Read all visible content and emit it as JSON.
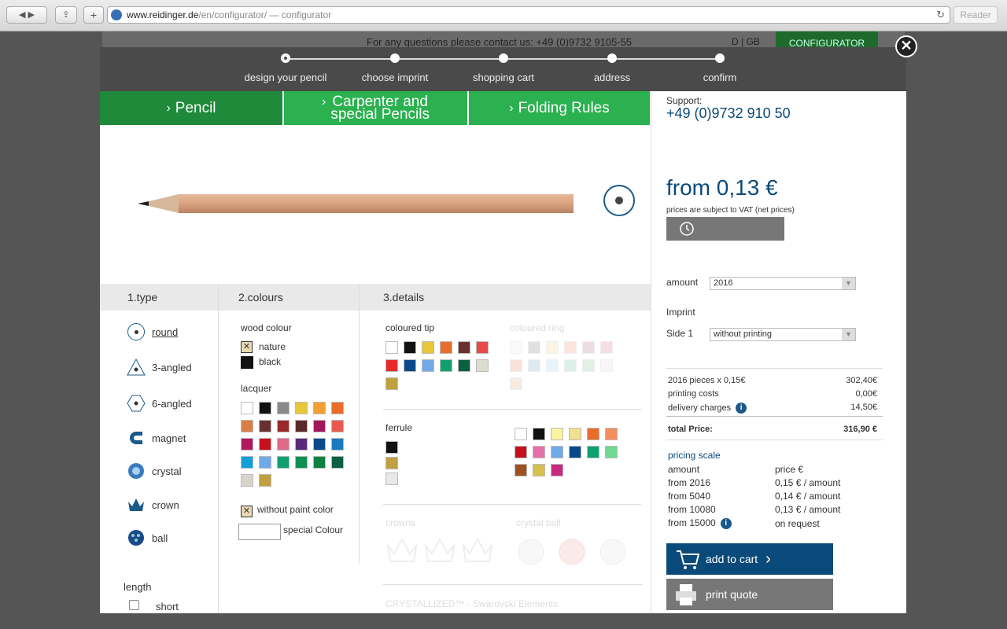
{
  "browser": {
    "url_host": "www.reidinger.de",
    "url_path": "/en/configurator/",
    "url_title": " — configurator",
    "reader": "Reader"
  },
  "background": {
    "contact": "For any questions please contact us: +49 (0)9732 9105-55",
    "lang_d": "D",
    "lang_sep": "|",
    "lang_gb": "GB",
    "configurator": "CONFIGURATOR"
  },
  "steps": [
    {
      "label": "design your pencil"
    },
    {
      "label": "choose imprint"
    },
    {
      "label": "shopping cart"
    },
    {
      "label": "address"
    },
    {
      "label": "confirm"
    }
  ],
  "close_icon": "close-icon",
  "tabs": {
    "pencil": "Pencil",
    "carpenter_1": "Carpenter and",
    "carpenter_2": "special Pencils",
    "folding": "Folding Rules"
  },
  "sections": {
    "type": "1.type",
    "colours": "2.colours",
    "details": "3.details"
  },
  "types": [
    "round",
    "3-angled",
    "6-angled",
    "magnet",
    "crystal",
    "crown",
    "ball"
  ],
  "length": {
    "title": "length",
    "option": "short"
  },
  "colours": {
    "wood_title": "wood colour",
    "wood": [
      "nature",
      "black"
    ],
    "lacquer_title": "lacquer",
    "lacquer_colors": [
      "#ffffff",
      "#111111",
      "#8a8a8a",
      "#e8c73a",
      "#f3a033",
      "#e86d2c",
      "#d97e45",
      "#6a3030",
      "#9a2a2a",
      "#5a2a2a",
      "#a0185a",
      "#e85a50",
      "#b01860",
      "#c8101c",
      "#e06a8a",
      "#5a2a7a",
      "#0a4a8a",
      "#1a7ac0",
      "#10a0d8",
      "#70a8e8",
      "#10a070",
      "#109050",
      "#108040",
      "#0a6040",
      "#d8d4cc",
      "#c0a040"
    ],
    "without_paint": "without paint color",
    "special": "special Colour"
  },
  "details": {
    "tip_title": "coloured tip",
    "tip_colors": [
      "#ffffff",
      "#111111",
      "#e8c73a",
      "#e86d2c",
      "#6a3030",
      "#e84a4a",
      "#e82a2a",
      "#0a4a8a",
      "#70a8e8",
      "#10a070",
      "#0a6040",
      "#dcdcd0",
      "#c0a040"
    ],
    "ring_title": "coloured ring",
    "ring_colors": [
      "#fafafa",
      "#e0e0e0",
      "#fbf6e4",
      "#fbe4dc",
      "#ecdce4",
      "#f8dde2",
      "#fbe0d8",
      "#e0e8f0",
      "#e8f4fb",
      "#dcf0e8",
      "#e0f0e4",
      "#f8f6f8",
      "#f6ece0"
    ],
    "ferrule_title": "ferrule",
    "ferrule_colors": [
      "#111111",
      "#c0a040",
      "#e8e8e8"
    ],
    "ferrule_colors2": [
      "#ffffff",
      "#111111",
      "#f8f4a0",
      "#f0e090",
      "#e86d2c",
      "#f09060",
      "#c8101c",
      "#e870a8",
      "#70a8e8",
      "#0a4a8a",
      "#10a070",
      "#70d890",
      "#a05020",
      "#d8c050",
      "#c82a80"
    ],
    "crowns_title": "crowns",
    "crystal_title": "crystal ball",
    "crystallized": "CRYSTALLIZED™ - Swarovski Elements"
  },
  "right": {
    "support_label": "Support:",
    "support_phone": "+49 (0)9732 910 50",
    "price": "from 0,13 €",
    "vat": "prices are subject to VAT (net prices)",
    "clock_icon": "clock-icon",
    "amount_label": "amount",
    "amount_value": "2016",
    "imprint_label": "Imprint",
    "side_label": "Side 1",
    "side_value": "without printing",
    "rows": [
      {
        "label": "2016 pieces x 0,15€",
        "value": "302,40€"
      },
      {
        "label": "printing costs",
        "value": "0,00€"
      },
      {
        "label": "delivery charges",
        "value": "14,50€"
      }
    ],
    "total_label": "total Price:",
    "total_value": "316,90 €",
    "scale_title": "pricing scale",
    "scale_head": [
      "amount",
      "price €"
    ],
    "scale": [
      {
        "a": "from  2016",
        "p": "0,15 € / amount"
      },
      {
        "a": "from  5040",
        "p": "0,14 € / amount"
      },
      {
        "a": "from  10080",
        "p": "0,13 € / amount"
      },
      {
        "a": "from 15000",
        "p": "on request"
      }
    ],
    "add_cart": "add to cart",
    "print_quote": "print quote",
    "accent": "#0a4a7a",
    "green": "#2bb14f",
    "dark_green": "#1f8a3a"
  }
}
